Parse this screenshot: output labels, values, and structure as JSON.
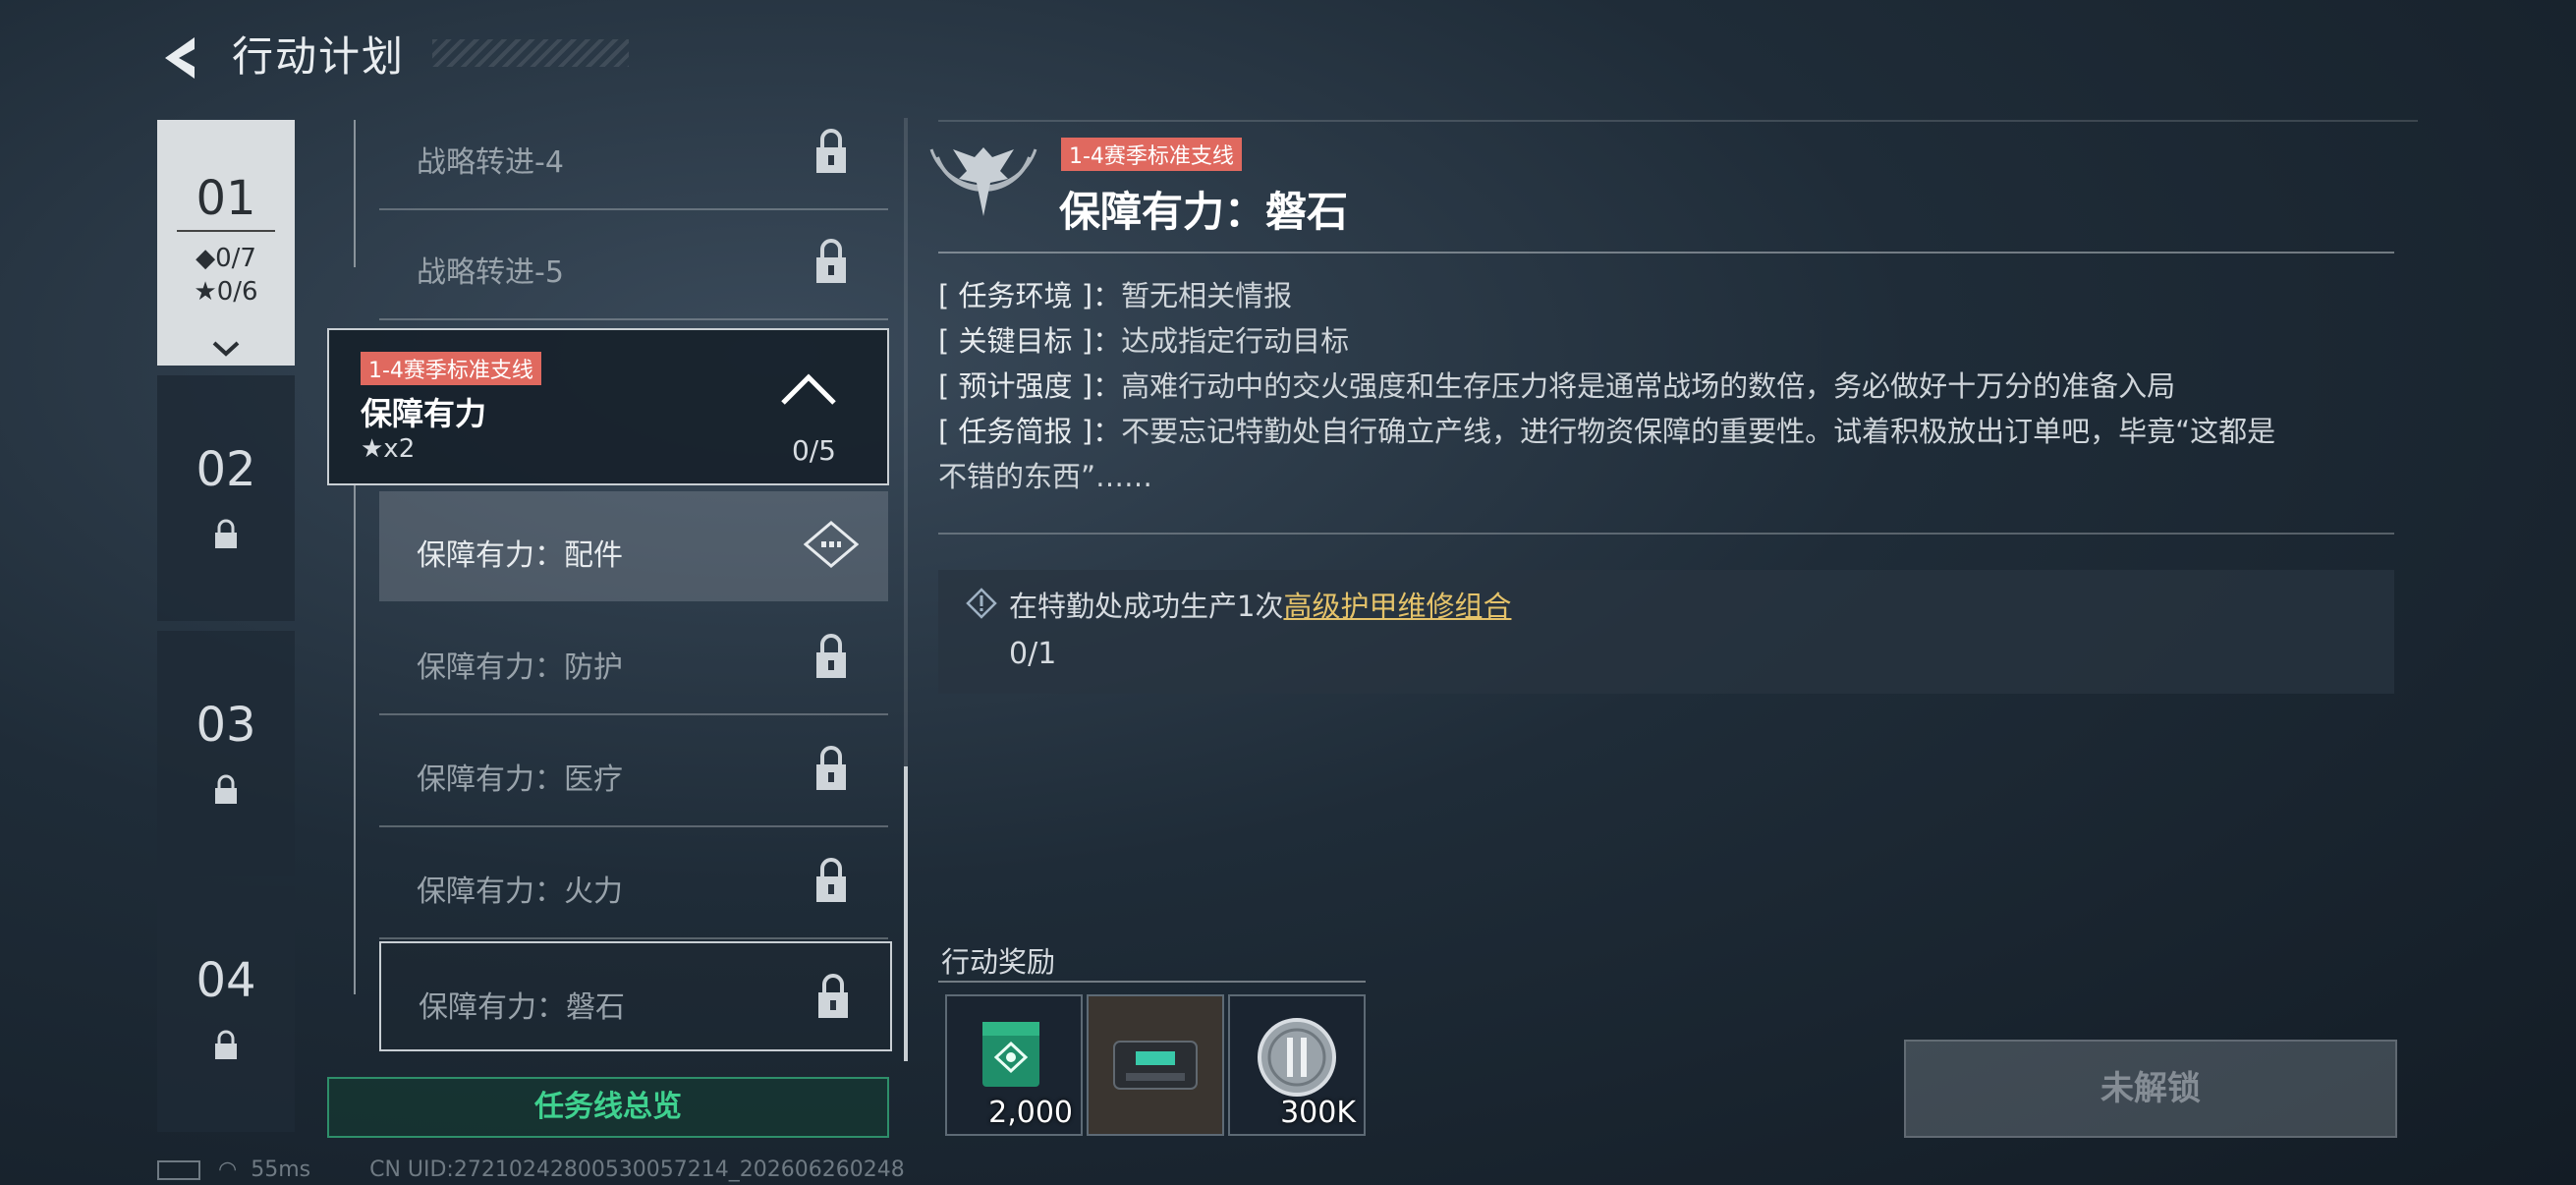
{
  "header": {
    "title": "行动计划"
  },
  "chapters": [
    {
      "num": "01",
      "diamonds": "◆0/7",
      "stars": "★0/6",
      "active": true
    },
    {
      "num": "02",
      "locked": true
    },
    {
      "num": "03",
      "locked": true
    },
    {
      "num": "04",
      "locked": true
    }
  ],
  "tasks_above": [
    {
      "label": "战略转进-4",
      "locked": true
    },
    {
      "label": "战略转进-5",
      "locked": true
    }
  ],
  "group": {
    "tag": "1-4赛季标准支线",
    "name": "保障有力",
    "stars": "★x2",
    "progress": "0/5"
  },
  "group_tasks": [
    {
      "label": "保障有力：配件",
      "state": "selected"
    },
    {
      "label": "保障有力：防护",
      "locked": true
    },
    {
      "label": "保障有力：医疗",
      "locked": true
    },
    {
      "label": "保障有力：火力",
      "locked": true
    },
    {
      "label": "保障有力：磐石",
      "locked": true,
      "current": true
    }
  ],
  "overview_button": "任务线总览",
  "detail": {
    "tag": "1-4赛季标准支线",
    "title": "保障有力：磐石",
    "env_key": "[ 任务环境 ]：",
    "env_val": "暂无相关情报",
    "goal_key": "[ 关键目标 ]：",
    "goal_val": "达成指定行动目标",
    "intensity_key": "[ 预计强度 ]：",
    "intensity_val": "高难行动中的交火强度和生存压力将是通常战场的数倍，务必做好十万分的准备入局",
    "brief_key": "[ 任务简报 ]：",
    "brief_val": "不要忘记特勤处自行确立产线，进行物资保障的重要性。试着积极放出订单吧，毕竟“这都是",
    "brief_val2": "不错的东西”……",
    "objective_prefix": "在特勤处成功生产1次",
    "objective_link": "高级护甲维修组合",
    "objective_progress": "0/1"
  },
  "rewards": {
    "title": "行动奖励",
    "items": [
      {
        "amount": "2,000"
      },
      {
        "amount": ""
      },
      {
        "amount": "300K"
      }
    ]
  },
  "unlock_button": "未解锁",
  "status": {
    "ping": "55ms",
    "uid": "CN UID:27210242800530057214_202606260248"
  },
  "colors": {
    "tag_red": "#e0695f",
    "green": "#3fd18f",
    "link_gold": "#e5c36a"
  }
}
